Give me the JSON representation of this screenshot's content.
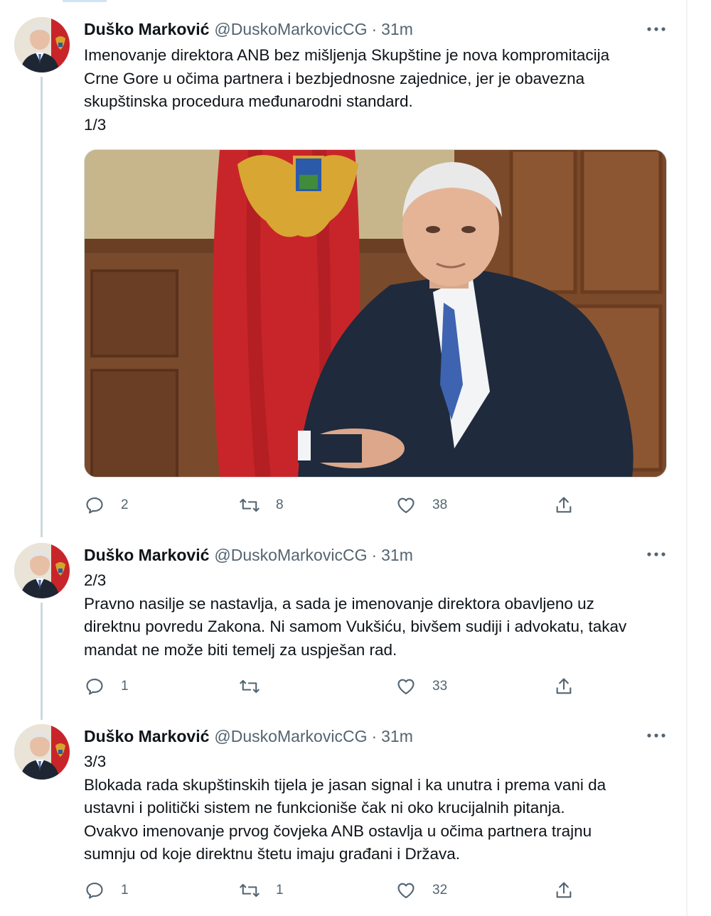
{
  "tweets": [
    {
      "author": "Duško Marković",
      "handle": "@DuskoMarkovicCG",
      "time": "31m",
      "lines": [
        "Imenovanje direktora ANB bez mišljenja Skupštine je nova kompromitacija",
        "Crne Gore u očima partnera i bezbjednosne zajednice, jer je obavezna",
        "skupštinska procedura međunarodni standard.",
        "1/3"
      ],
      "replies": "2",
      "retweets": "8",
      "likes": "38",
      "has_media": true
    },
    {
      "author": "Duško Marković",
      "handle": "@DuskoMarkovicCG",
      "time": "31m",
      "lines": [
        "2/3",
        "Pravno nasilje se nastavlja, a sada je imenovanje direktora obavljeno uz",
        "direktnu povredu Zakona. Ni samom Vukšiću, bivšem sudiji i advokatu, takav",
        "mandat ne može biti temelj za uspješan rad."
      ],
      "replies": "1",
      "retweets": "",
      "likes": "33",
      "has_media": false
    },
    {
      "author": "Duško Marković",
      "handle": "@DuskoMarkovicCG",
      "time": "31m",
      "lines": [
        "3/3",
        "Blokada rada skupštinskih tijela je jasan signal i ka unutra i prema vani da",
        "ustavni i politički sistem ne funkcioniše čak ni oko krucijalnih pitanja.",
        "Ovakvo imenovanje prvog čovjeka ANB ostavlja u očima partnera trajnu",
        "sumnju od koje direktnu štetu imaju građani i Država."
      ],
      "replies": "1",
      "retweets": "1",
      "likes": "32",
      "has_media": false
    }
  ],
  "separator": "·",
  "icons": {
    "reply": "reply-icon",
    "retweet": "retweet-icon",
    "like": "heart-icon",
    "share": "share-icon",
    "more": "more-icon"
  },
  "colors": {
    "text_primary": "#0f1419",
    "text_secondary": "#536471",
    "thread_line": "#cfd9de",
    "flag_red": "#c8252a"
  }
}
